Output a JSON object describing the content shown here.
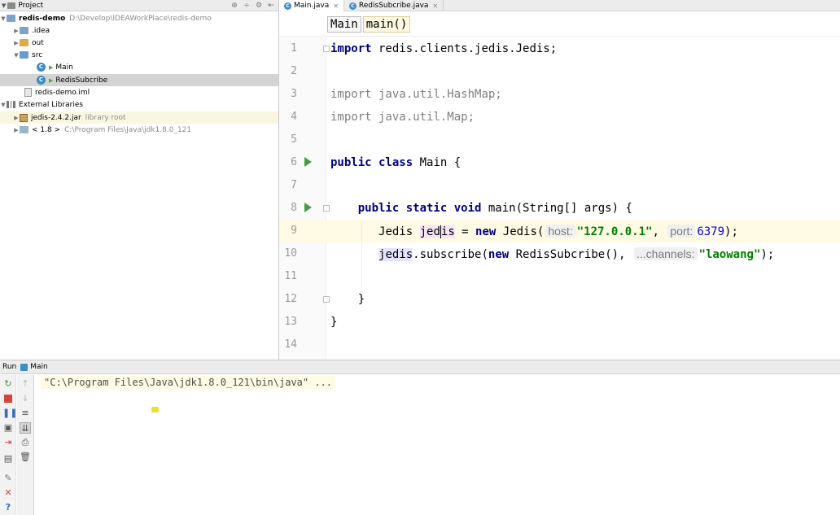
{
  "project_panel": {
    "title": "Project",
    "header_buttons": [
      "⊕",
      "÷",
      "⚙",
      "⇤"
    ],
    "tree": [
      {
        "label": "redis-demo",
        "path": "D:\\Develop\\IDEAWorkPlace\\redis-demo",
        "icon": "folder-icon"
      },
      {
        "label": ".idea",
        "icon": "folder-icon"
      },
      {
        "label": "out",
        "icon": "folder-icon"
      },
      {
        "label": "src",
        "icon": "source-folder-icon"
      },
      {
        "label": "Main",
        "icon": "java-class-icon"
      },
      {
        "label": "RedisSubcribe",
        "icon": "java-class-icon"
      },
      {
        "label": "redis-demo.iml",
        "icon": "module-file-icon"
      },
      {
        "label": "External Libraries",
        "icon": "library-icon"
      },
      {
        "label": "jedis-2.4.2.jar",
        "note": "library root",
        "icon": "jar-icon"
      },
      {
        "label": "< 1.8 >",
        "path": "C:\\Program Files\\Java\\jdk1.8.0_121",
        "icon": "jdk-icon"
      }
    ]
  },
  "editor": {
    "tabs": [
      {
        "label": "Main.java",
        "active": true
      },
      {
        "label": "RedisSubcribe.java",
        "active": false
      }
    ],
    "breadcrumbs": [
      "Main",
      "main()"
    ],
    "line_numbers": [
      "1",
      "2",
      "3",
      "4",
      "5",
      "6",
      "7",
      "8",
      "9",
      "10",
      "11",
      "12",
      "13",
      "14"
    ],
    "code": {
      "l1_kw": "import",
      "l1_rest": " redis.clients.jedis.Jedis;",
      "l3_kw": "import",
      "l3_rest": " java.util.HashMap;",
      "l4_kw": "import",
      "l4_rest": " java.util.Map;",
      "l6_kw": "public class",
      "l6_rest": " Main {",
      "l8_indent": "    ",
      "l8_kw": "public static void",
      "l8_rest": " main(String[] args) {",
      "l9_indent": "       ",
      "l9_type": "Jedis ",
      "l9_var_a": "jed",
      "l9_var_b": "is",
      "l9_eq": " = ",
      "l9_kw": "new",
      "l9_ctor": " Jedis(",
      "l9_hint1": "host:",
      "l9_str": "\"127.0.0.1\"",
      "l9_comma": ", ",
      "l9_hint2": "port:",
      "l9_num": "6379",
      "l9_end": ");",
      "l10_indent": "       ",
      "l10_var": "jedis",
      "l10_call": ".subscribe(",
      "l10_kw": "new",
      "l10_cls": " RedisSubcribe(), ",
      "l10_hint": "...channels:",
      "l10_str": "\"laowang\"",
      "l10_end": ");",
      "l12_text": "    }",
      "l13_text": "}"
    }
  },
  "run_panel": {
    "tab_label": "Run",
    "config_name": "Main",
    "console_output": "\"C:\\Program Files\\Java\\jdk1.8.0_121\\bin\\java\" ..."
  }
}
